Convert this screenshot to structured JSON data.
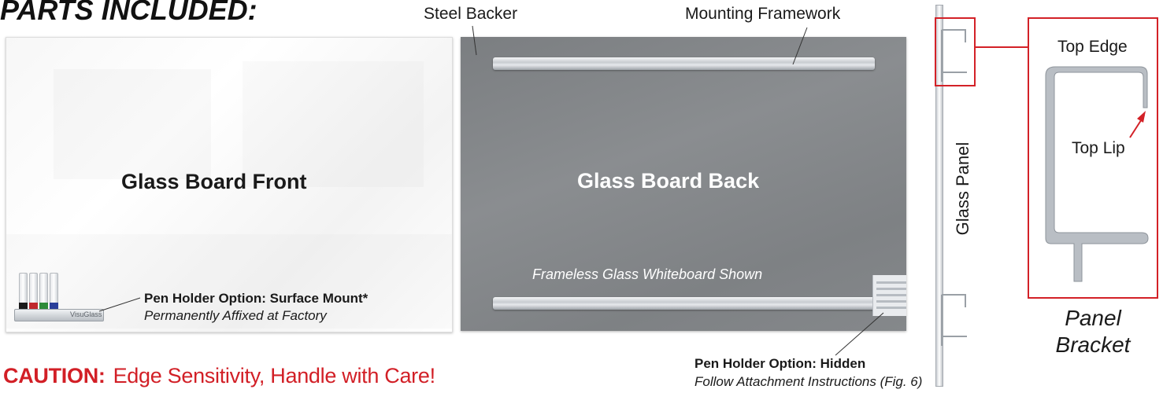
{
  "heading": "PARTS INCLUDED:",
  "callouts": {
    "steel_backer": "Steel Backer",
    "mounting_framework": "Mounting Framework",
    "top_edge": "Top Edge",
    "top_lip": "Top Lip"
  },
  "front_board": {
    "title": "Glass Board Front",
    "pen_holder_title": "Pen Holder Option: Surface Mount*",
    "pen_holder_note": "Permanently Affixed at Factory",
    "tray_logo": "VisuGlass",
    "marker_cap_colors": [
      "#1a1a1a",
      "#c0282d",
      "#2e8b3a",
      "#2a3f9a"
    ]
  },
  "back_board": {
    "title": "Glass Board Back",
    "note": "Frameless Glass Whiteboard Shown"
  },
  "hidden_holder": {
    "title": "Pen Holder Option: Hidden",
    "note": "Follow Attachment Instructions (Fig. 6)"
  },
  "caution": {
    "lead": "CAUTION:",
    "message": "Edge Sensitivity, Handle with Care!"
  },
  "glass_panel_label": "Glass Panel",
  "panel_bracket": {
    "line1": "Panel",
    "line2": "Bracket"
  },
  "colors": {
    "accent_red": "#d32127",
    "steel_gray": "#818487",
    "aluminum": "#b9bec4"
  }
}
